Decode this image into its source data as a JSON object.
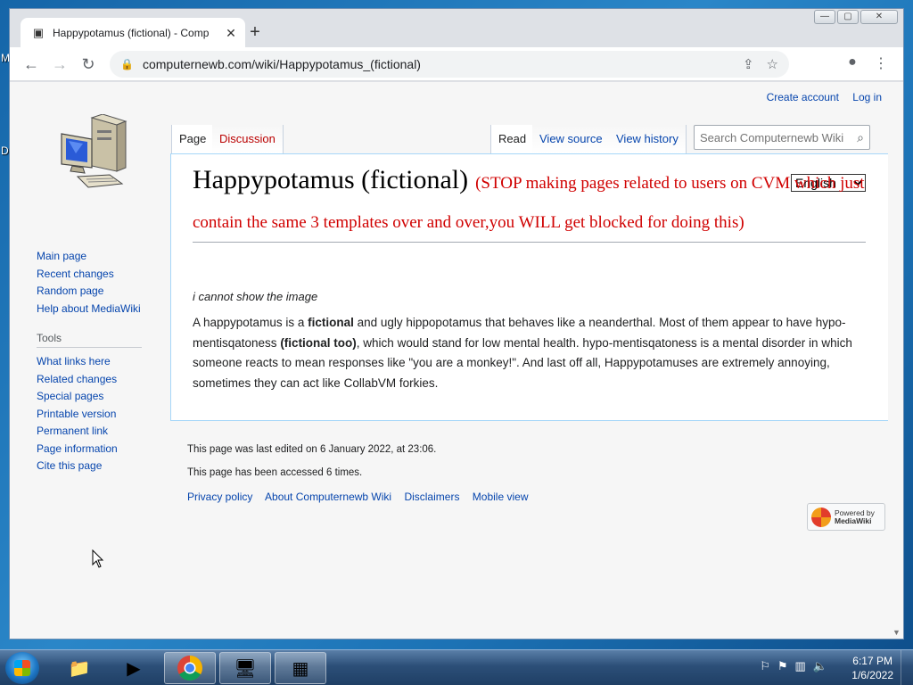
{
  "browser": {
    "tab_title": "Happypotamus (fictional) - Comp",
    "new_tab": "+",
    "tab_close": "✕",
    "url": "computernewb.com/wiki/Happypotamus_(fictional)",
    "window_buttons": [
      "—",
      "▢",
      "✕"
    ]
  },
  "wiki": {
    "personal": [
      "Create account",
      "Log in"
    ],
    "tabs_left": [
      "Page",
      "Discussion"
    ],
    "tabs_right": [
      "Read",
      "View source",
      "View history"
    ],
    "search_placeholder": "Search Computernewb Wiki",
    "sidebar_nav": [
      "Main page",
      "Recent changes",
      "Random page",
      "Help about MediaWiki"
    ],
    "tools_heading": "Tools",
    "sidebar_tools": [
      "What links here",
      "Related changes",
      "Special pages",
      "Printable version",
      "Permanent link",
      "Page information",
      "Cite this page"
    ],
    "language_selected": "English",
    "title": "Happypotamus (fictional)",
    "warning": "(STOP making pages related to users on CVM which just contain the same 3 templates over and over,you WILL get blocked for doing this)",
    "image_note": "i cannot show the image",
    "body": {
      "p1": "A happypotamus is a ",
      "b1": "fictional",
      "p2": " and ugly hippopotamus that behaves like a neanderthal. Most of them appear to have hypo-mentisqatoness ",
      "b2": "(fictional too)",
      "p3": ", which would stand for low mental health. hypo-mentisqatoness is a mental disorder in which someone reacts to mean responses like \"you are a monkey!\". And last off all, Happypotamuses are extremely annoying, sometimes they can act like CollabVM forkies."
    },
    "footer_edited": "This page was last edited on 6 January 2022, at 23:06.",
    "footer_accessed": "This page has been accessed 6 times.",
    "footer_links": [
      "Privacy policy",
      "About Computernewb Wiki",
      "Disclaimers",
      "Mobile view"
    ],
    "powered_by": [
      "Powered by",
      "MediaWiki"
    ]
  },
  "taskbar": {
    "time": "6:17 PM",
    "date": "1/6/2022"
  },
  "colors": {
    "link": "#0645ad",
    "redlink": "#ba0000",
    "warning": "#d00000"
  }
}
